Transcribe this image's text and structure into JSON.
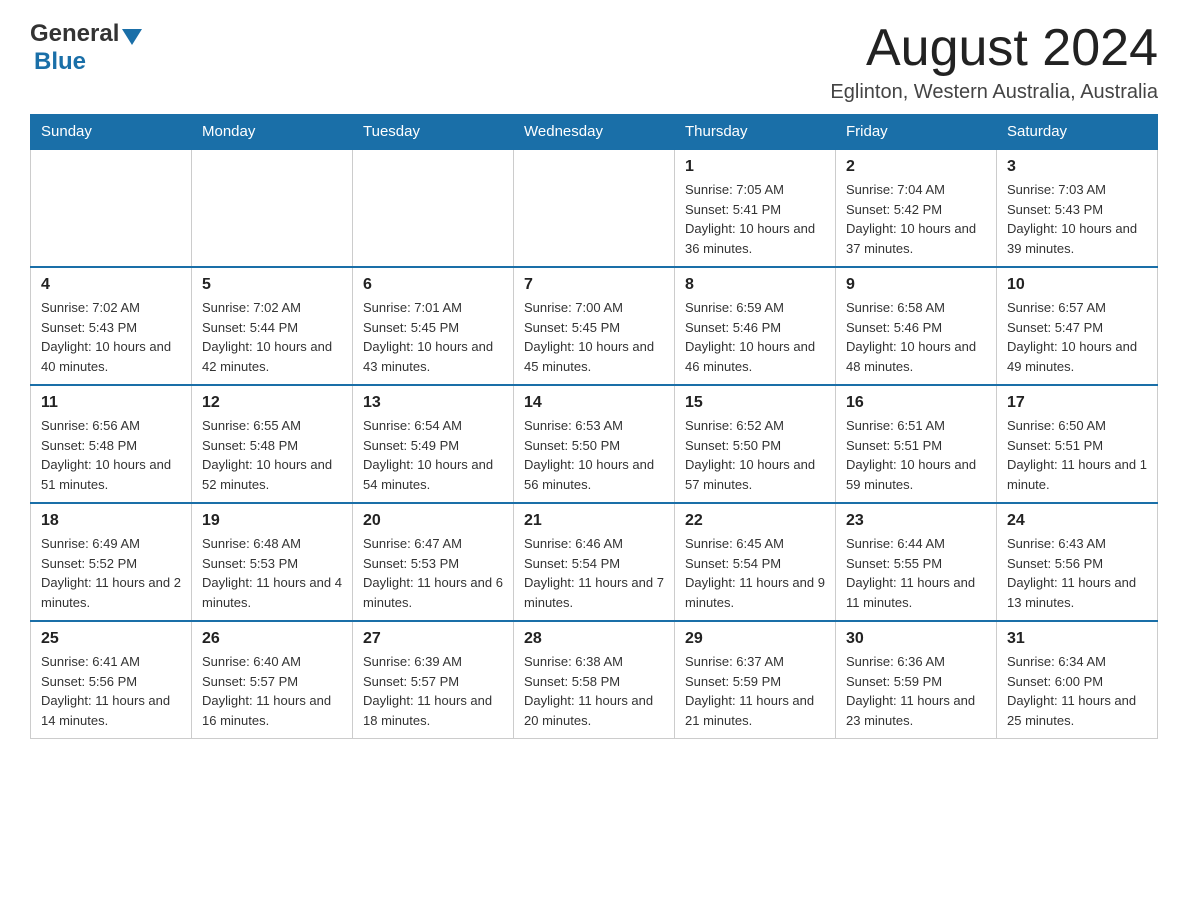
{
  "header": {
    "logo_general": "General",
    "logo_blue": "Blue",
    "month_title": "August 2024",
    "location": "Eglinton, Western Australia, Australia"
  },
  "weekdays": [
    "Sunday",
    "Monday",
    "Tuesday",
    "Wednesday",
    "Thursday",
    "Friday",
    "Saturday"
  ],
  "weeks": [
    [
      {
        "day": "",
        "info": ""
      },
      {
        "day": "",
        "info": ""
      },
      {
        "day": "",
        "info": ""
      },
      {
        "day": "",
        "info": ""
      },
      {
        "day": "1",
        "info": "Sunrise: 7:05 AM\nSunset: 5:41 PM\nDaylight: 10 hours and 36 minutes."
      },
      {
        "day": "2",
        "info": "Sunrise: 7:04 AM\nSunset: 5:42 PM\nDaylight: 10 hours and 37 minutes."
      },
      {
        "day": "3",
        "info": "Sunrise: 7:03 AM\nSunset: 5:43 PM\nDaylight: 10 hours and 39 minutes."
      }
    ],
    [
      {
        "day": "4",
        "info": "Sunrise: 7:02 AM\nSunset: 5:43 PM\nDaylight: 10 hours and 40 minutes."
      },
      {
        "day": "5",
        "info": "Sunrise: 7:02 AM\nSunset: 5:44 PM\nDaylight: 10 hours and 42 minutes."
      },
      {
        "day": "6",
        "info": "Sunrise: 7:01 AM\nSunset: 5:45 PM\nDaylight: 10 hours and 43 minutes."
      },
      {
        "day": "7",
        "info": "Sunrise: 7:00 AM\nSunset: 5:45 PM\nDaylight: 10 hours and 45 minutes."
      },
      {
        "day": "8",
        "info": "Sunrise: 6:59 AM\nSunset: 5:46 PM\nDaylight: 10 hours and 46 minutes."
      },
      {
        "day": "9",
        "info": "Sunrise: 6:58 AM\nSunset: 5:46 PM\nDaylight: 10 hours and 48 minutes."
      },
      {
        "day": "10",
        "info": "Sunrise: 6:57 AM\nSunset: 5:47 PM\nDaylight: 10 hours and 49 minutes."
      }
    ],
    [
      {
        "day": "11",
        "info": "Sunrise: 6:56 AM\nSunset: 5:48 PM\nDaylight: 10 hours and 51 minutes."
      },
      {
        "day": "12",
        "info": "Sunrise: 6:55 AM\nSunset: 5:48 PM\nDaylight: 10 hours and 52 minutes."
      },
      {
        "day": "13",
        "info": "Sunrise: 6:54 AM\nSunset: 5:49 PM\nDaylight: 10 hours and 54 minutes."
      },
      {
        "day": "14",
        "info": "Sunrise: 6:53 AM\nSunset: 5:50 PM\nDaylight: 10 hours and 56 minutes."
      },
      {
        "day": "15",
        "info": "Sunrise: 6:52 AM\nSunset: 5:50 PM\nDaylight: 10 hours and 57 minutes."
      },
      {
        "day": "16",
        "info": "Sunrise: 6:51 AM\nSunset: 5:51 PM\nDaylight: 10 hours and 59 minutes."
      },
      {
        "day": "17",
        "info": "Sunrise: 6:50 AM\nSunset: 5:51 PM\nDaylight: 11 hours and 1 minute."
      }
    ],
    [
      {
        "day": "18",
        "info": "Sunrise: 6:49 AM\nSunset: 5:52 PM\nDaylight: 11 hours and 2 minutes."
      },
      {
        "day": "19",
        "info": "Sunrise: 6:48 AM\nSunset: 5:53 PM\nDaylight: 11 hours and 4 minutes."
      },
      {
        "day": "20",
        "info": "Sunrise: 6:47 AM\nSunset: 5:53 PM\nDaylight: 11 hours and 6 minutes."
      },
      {
        "day": "21",
        "info": "Sunrise: 6:46 AM\nSunset: 5:54 PM\nDaylight: 11 hours and 7 minutes."
      },
      {
        "day": "22",
        "info": "Sunrise: 6:45 AM\nSunset: 5:54 PM\nDaylight: 11 hours and 9 minutes."
      },
      {
        "day": "23",
        "info": "Sunrise: 6:44 AM\nSunset: 5:55 PM\nDaylight: 11 hours and 11 minutes."
      },
      {
        "day": "24",
        "info": "Sunrise: 6:43 AM\nSunset: 5:56 PM\nDaylight: 11 hours and 13 minutes."
      }
    ],
    [
      {
        "day": "25",
        "info": "Sunrise: 6:41 AM\nSunset: 5:56 PM\nDaylight: 11 hours and 14 minutes."
      },
      {
        "day": "26",
        "info": "Sunrise: 6:40 AM\nSunset: 5:57 PM\nDaylight: 11 hours and 16 minutes."
      },
      {
        "day": "27",
        "info": "Sunrise: 6:39 AM\nSunset: 5:57 PM\nDaylight: 11 hours and 18 minutes."
      },
      {
        "day": "28",
        "info": "Sunrise: 6:38 AM\nSunset: 5:58 PM\nDaylight: 11 hours and 20 minutes."
      },
      {
        "day": "29",
        "info": "Sunrise: 6:37 AM\nSunset: 5:59 PM\nDaylight: 11 hours and 21 minutes."
      },
      {
        "day": "30",
        "info": "Sunrise: 6:36 AM\nSunset: 5:59 PM\nDaylight: 11 hours and 23 minutes."
      },
      {
        "day": "31",
        "info": "Sunrise: 6:34 AM\nSunset: 6:00 PM\nDaylight: 11 hours and 25 minutes."
      }
    ]
  ]
}
